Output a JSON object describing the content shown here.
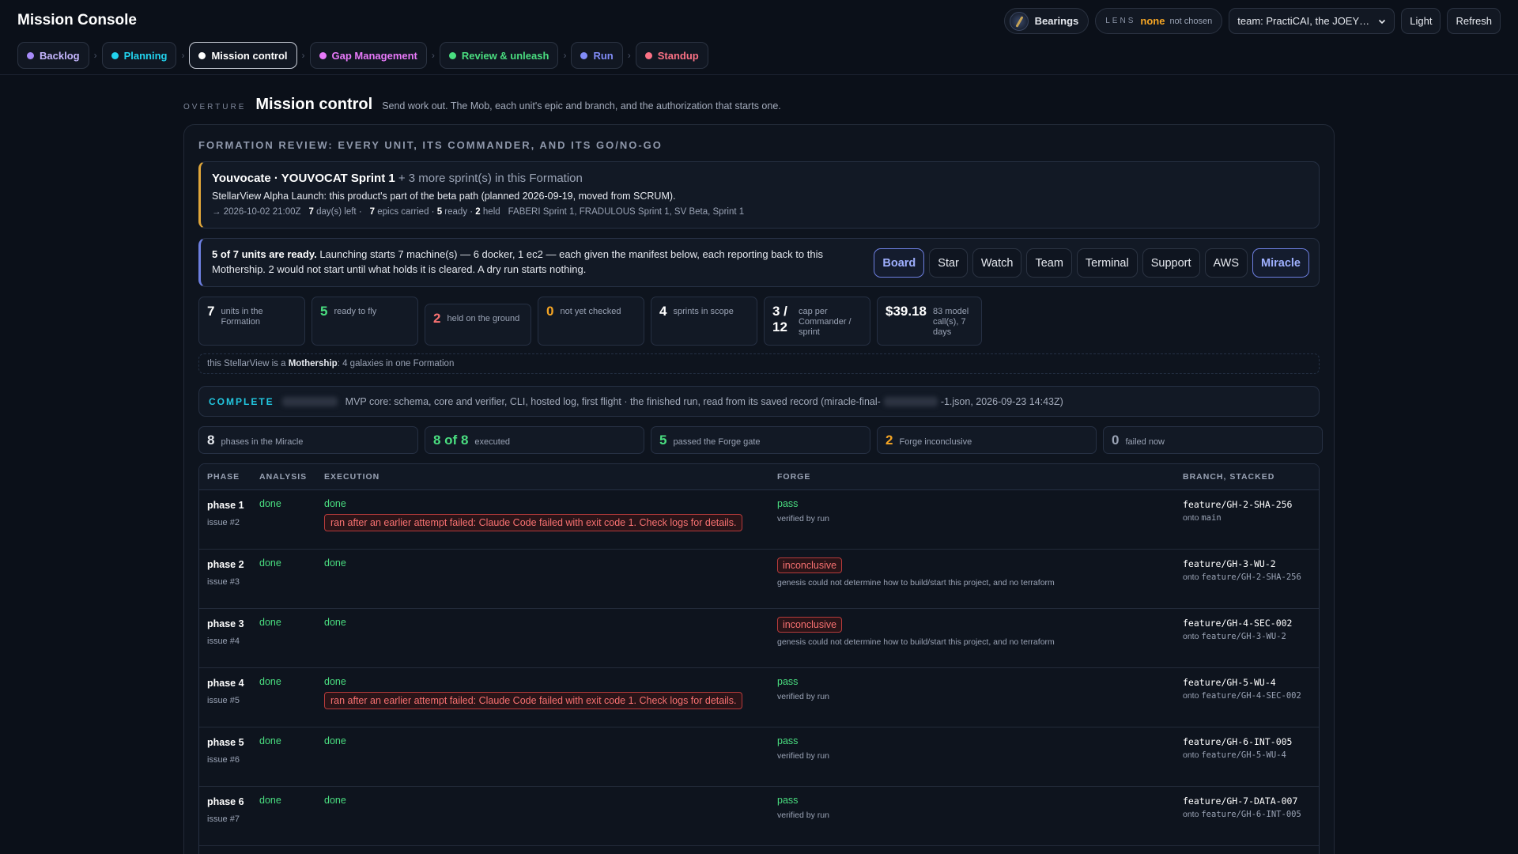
{
  "app": {
    "title": "Mission Console"
  },
  "topbar": {
    "bearings": "Bearings",
    "lens_label": "LENS",
    "lens_value": "none",
    "lens_sub": "not chosen",
    "team": "team: PractiCAI, the JOEY…",
    "light": "Light",
    "refresh": "Refresh"
  },
  "tabs": [
    {
      "label": "Backlog",
      "color": "#a78bfa"
    },
    {
      "label": "Planning",
      "color": "#22d3ee"
    },
    {
      "label": "Mission control",
      "color": "#ffffff"
    },
    {
      "label": "Gap Management",
      "color": "#e879f9"
    },
    {
      "label": "Review & unleash",
      "color": "#4ade80"
    },
    {
      "label": "Run",
      "color": "#818cf8"
    },
    {
      "label": "Standup",
      "color": "#fb7185"
    }
  ],
  "overture": {
    "eyebrow": "OVERTURE",
    "title": "Mission control",
    "desc": "Send work out. The Mob, each unit's epic and branch, and the authorization that starts one."
  },
  "formation": {
    "title": "FORMATION REVIEW: EVERY UNIT, ITS COMMANDER, AND ITS GO/NO-GO",
    "sprint_title": "Youvocate · YOUVOCAT Sprint 1",
    "sprint_more": "+ 3 more sprint(s) in this Formation",
    "sprint_desc": "StellarView Alpha Launch: this product's part of the beta path (planned 2026-09-19, moved from SCRUM).",
    "meta_date": "→ 2026-10-02 21:00Z",
    "meta_days_n": "7",
    "meta_days": "day(s) left ·",
    "meta_epics_n": "7",
    "meta_epics": "epics carried ·",
    "meta_ready_n": "5",
    "meta_ready": "ready ·",
    "meta_held_n": "2",
    "meta_held": "held",
    "meta_sprints": "FABERI Sprint 1, FRADULOUS Sprint 1, SV Beta, Sprint 1",
    "ready_bold": "5 of 7 units are ready.",
    "ready_text": "Launching starts 7 machine(s) — 6 docker, 1 ec2 — each given the manifest below, each reporting back to this Mothership. 2 would not start until what holds it is cleared. A dry run starts nothing.",
    "views": [
      "Board",
      "Star",
      "Watch",
      "Team",
      "Terminal",
      "Support",
      "AWS",
      "Miracle"
    ],
    "stats": [
      {
        "num": "7",
        "label": "units in the Formation",
        "color": "#ffffff"
      },
      {
        "num": "5",
        "label": "ready to fly",
        "color": "#4ade80"
      },
      {
        "num": "2",
        "label": "held on the ground",
        "color": "#f87171"
      },
      {
        "num": "0",
        "label": "not yet checked",
        "color": "#f5a524"
      },
      {
        "num": "4",
        "label": "sprints in scope",
        "color": "#ffffff"
      },
      {
        "num": "3 / 12",
        "label": "cap per Commander / sprint",
        "color": "#ffffff"
      },
      {
        "num": "$39.18",
        "label": "83 model call(s), 7 days",
        "color": "#ffffff"
      }
    ],
    "note_pre": "this StellarView is a",
    "note_bold": "Mothership",
    "note_post": ": 4 galaxies in one Formation"
  },
  "complete": {
    "label": "COMPLETE",
    "text": "MVP core: schema, core and verifier, CLI, hosted log, first flight · the finished run, read from its saved record (miracle-final-",
    "text_end": "-1.json, 2026-09-23 14:43Z)"
  },
  "stats2": [
    {
      "num": "8",
      "label": "phases in the Miracle",
      "color": "#ffffff"
    },
    {
      "num": "8 of 8",
      "label": "executed",
      "color": "#4ade80"
    },
    {
      "num": "5",
      "label": "passed the Forge gate",
      "color": "#4ade80"
    },
    {
      "num": "2",
      "label": "Forge inconclusive",
      "color": "#f5a524"
    },
    {
      "num": "0",
      "label": "failed now",
      "color": "#9aa3b5"
    }
  ],
  "table": {
    "headers": [
      "PHASE",
      "ANALYSIS",
      "EXECUTION",
      "FORGE",
      "BRANCH, STACKED"
    ],
    "rows": [
      {
        "phase": "phase 1",
        "issue": "issue #2",
        "analysis": "done",
        "execution": "done",
        "error": "ran after an earlier attempt failed: Claude Code failed with exit code 1. Check logs for details.",
        "forge": "pass",
        "forge_note": "verified by run",
        "branch": "feature/GH-2-SHA-256",
        "onto_label": "onto",
        "onto": "main"
      },
      {
        "phase": "phase 2",
        "issue": "issue #3",
        "analysis": "done",
        "execution": "done",
        "error": "",
        "forge": "inconclusive",
        "forge_note": "genesis could not determine how to build/start this project, and no terraform",
        "branch": "feature/GH-3-WU-2",
        "onto_label": "onto",
        "onto": "feature/GH-2-SHA-256"
      },
      {
        "phase": "phase 3",
        "issue": "issue #4",
        "analysis": "done",
        "execution": "done",
        "error": "",
        "forge": "inconclusive",
        "forge_note": "genesis could not determine how to build/start this project, and no terraform",
        "branch": "feature/GH-4-SEC-002",
        "onto_label": "onto",
        "onto": "feature/GH-3-WU-2"
      },
      {
        "phase": "phase 4",
        "issue": "issue #5",
        "analysis": "done",
        "execution": "done",
        "error": "ran after an earlier attempt failed: Claude Code failed with exit code 1. Check logs for details.",
        "forge": "pass",
        "forge_note": "verified by run",
        "branch": "feature/GH-5-WU-4",
        "onto_label": "onto",
        "onto": "feature/GH-4-SEC-002"
      },
      {
        "phase": "phase 5",
        "issue": "issue #6",
        "analysis": "done",
        "execution": "done",
        "error": "",
        "forge": "pass",
        "forge_note": "verified by run",
        "branch": "feature/GH-6-INT-005",
        "onto_label": "onto",
        "onto": "feature/GH-5-WU-4"
      },
      {
        "phase": "phase 6",
        "issue": "issue #7",
        "analysis": "done",
        "execution": "done",
        "error": "",
        "forge": "pass",
        "forge_note": "verified by run",
        "branch": "feature/GH-7-DATA-007",
        "onto_label": "onto",
        "onto": "feature/GH-6-INT-005"
      }
    ]
  }
}
